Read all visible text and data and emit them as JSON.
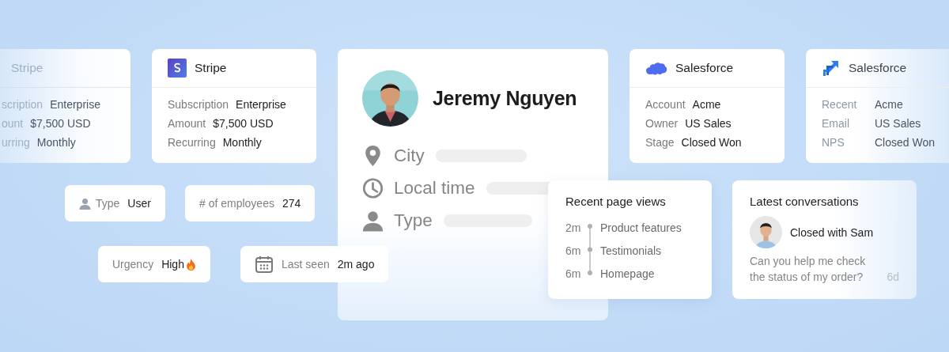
{
  "stripe_cards": [
    {
      "title": "Stripe",
      "faded": true,
      "rows": [
        {
          "label": "scription",
          "value": "Enterprise"
        },
        {
          "label": "ount",
          "value": "$7,500 USD"
        },
        {
          "label": "urring",
          "value": "Monthly"
        }
      ]
    },
    {
      "title": "Stripe",
      "faded": false,
      "rows": [
        {
          "label": "Subscription",
          "value": "Enterprise"
        },
        {
          "label": "Amount",
          "value": "$7,500 USD"
        },
        {
          "label": "Recurring",
          "value": "Monthly"
        }
      ]
    }
  ],
  "profile": {
    "name": "Jeremy Nguyen",
    "fields": [
      {
        "label": "City"
      },
      {
        "label": "Local time"
      },
      {
        "label": "Type"
      }
    ]
  },
  "crm_cards": [
    {
      "title": "Salesforce",
      "faded": false,
      "rows": [
        {
          "label": "Account",
          "value": "Acme"
        },
        {
          "label": "Owner",
          "value": "US Sales"
        },
        {
          "label": "Stage",
          "value": "Closed Won"
        }
      ]
    },
    {
      "title": "Salesforce",
      "faded": true,
      "rows": [
        {
          "label": "Recent",
          "value": "Acme"
        },
        {
          "label": "Email",
          "value": "US Sales"
        },
        {
          "label": "NPS",
          "value": "Closed Won"
        }
      ]
    }
  ],
  "chips": [
    {
      "label": "Type",
      "value": "User"
    },
    {
      "label": "# of employees",
      "value": "274"
    },
    {
      "label": "Urgency",
      "value": "High"
    },
    {
      "label": "Last seen",
      "value": "2m ago"
    }
  ],
  "page_views": {
    "title": "Recent page views",
    "items": [
      {
        "time": "2m",
        "page": "Product features"
      },
      {
        "time": "6m",
        "page": "Testimonials"
      },
      {
        "time": "6m",
        "page": "Homepage"
      }
    ]
  },
  "conversations": {
    "title": "Latest conversations",
    "status": "Closed with Sam",
    "message": "Can you help me check the status of my order?",
    "age": "6d"
  }
}
